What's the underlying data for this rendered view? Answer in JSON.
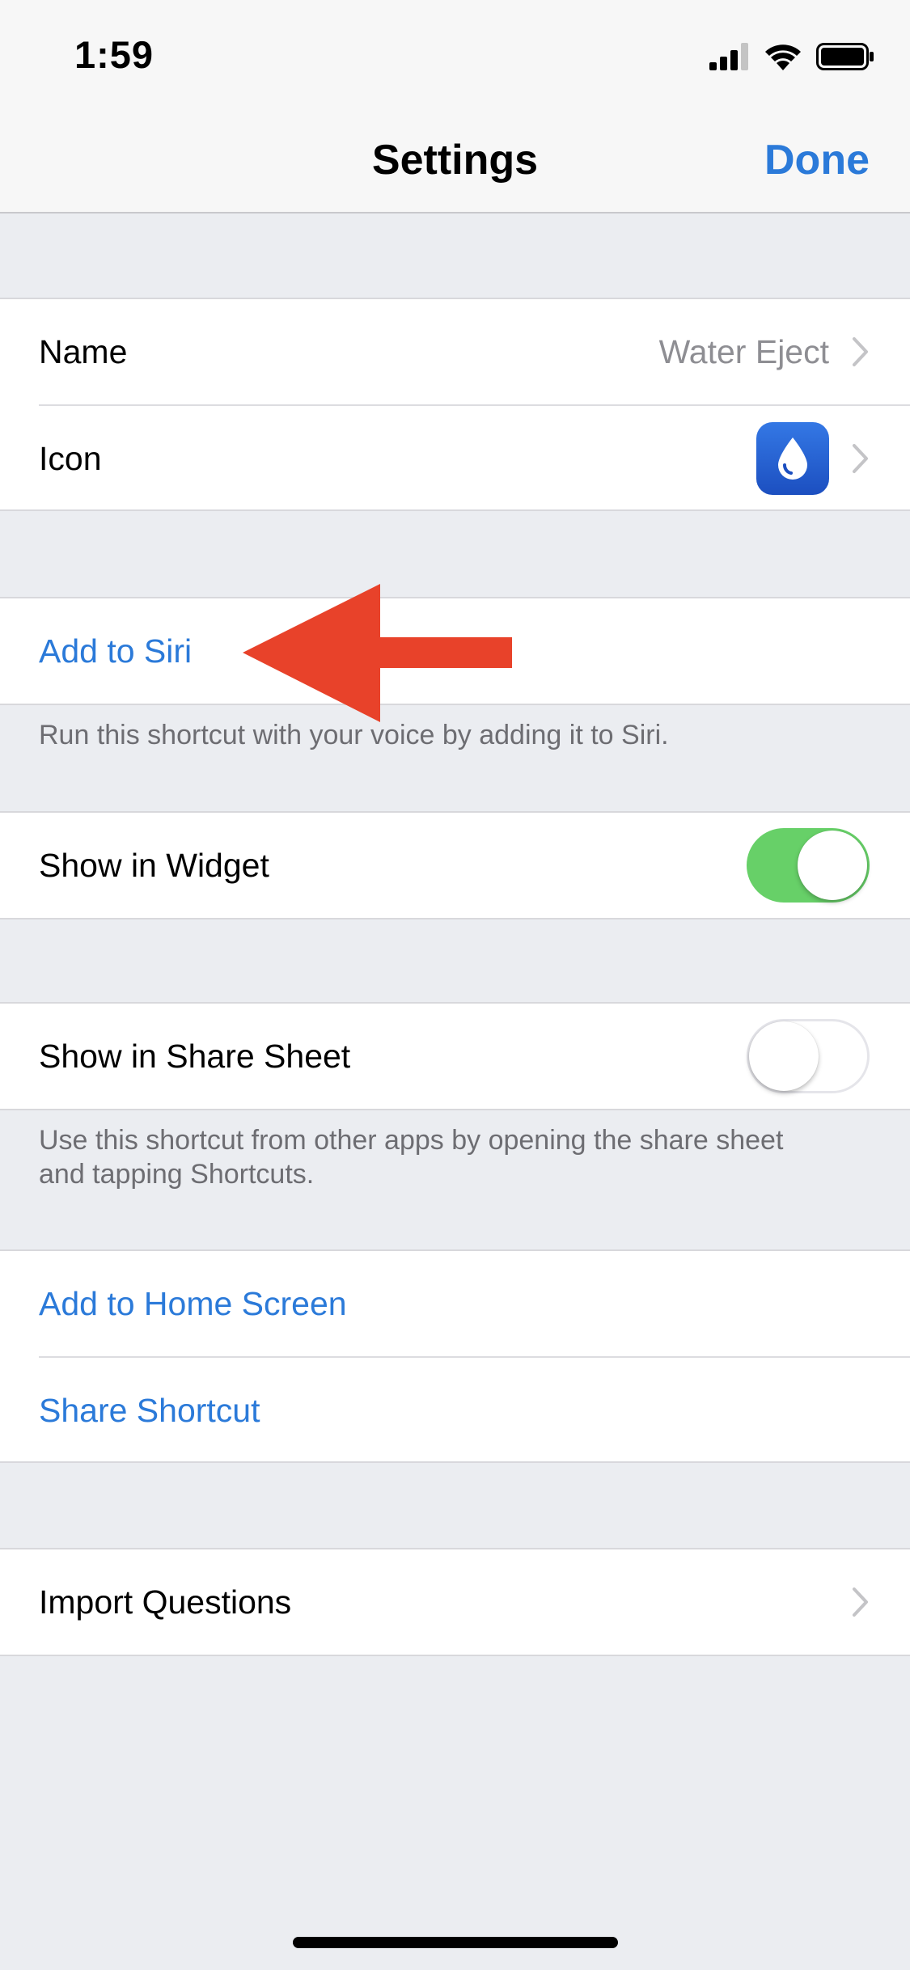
{
  "status_bar": {
    "time": "1:59",
    "icons": [
      "cellular-signal-icon",
      "wifi-icon",
      "battery-icon"
    ]
  },
  "nav": {
    "title": "Settings",
    "done_label": "Done"
  },
  "colors": {
    "accent": "#2b7ad9",
    "toggle_on": "#67d068",
    "arrow": "#e8422a",
    "background": "#ebedf1"
  },
  "sections": {
    "name_row": {
      "label": "Name",
      "value": "Water Eject"
    },
    "icon_row": {
      "label": "Icon",
      "icon": "water-drop-icon"
    },
    "add_to_siri": {
      "label": "Add to Siri",
      "footer": "Run this shortcut with your voice by adding it to Siri."
    },
    "show_in_widget": {
      "label": "Show in Widget",
      "enabled": true
    },
    "show_in_share_sheet": {
      "label": "Show in Share Sheet",
      "enabled": false,
      "footer": "Use this shortcut from other apps by opening the share sheet and tapping Shortcuts."
    },
    "add_to_home_screen": {
      "label": "Add to Home Screen"
    },
    "share_shortcut": {
      "label": "Share Shortcut"
    },
    "import_questions": {
      "label": "Import Questions"
    }
  }
}
